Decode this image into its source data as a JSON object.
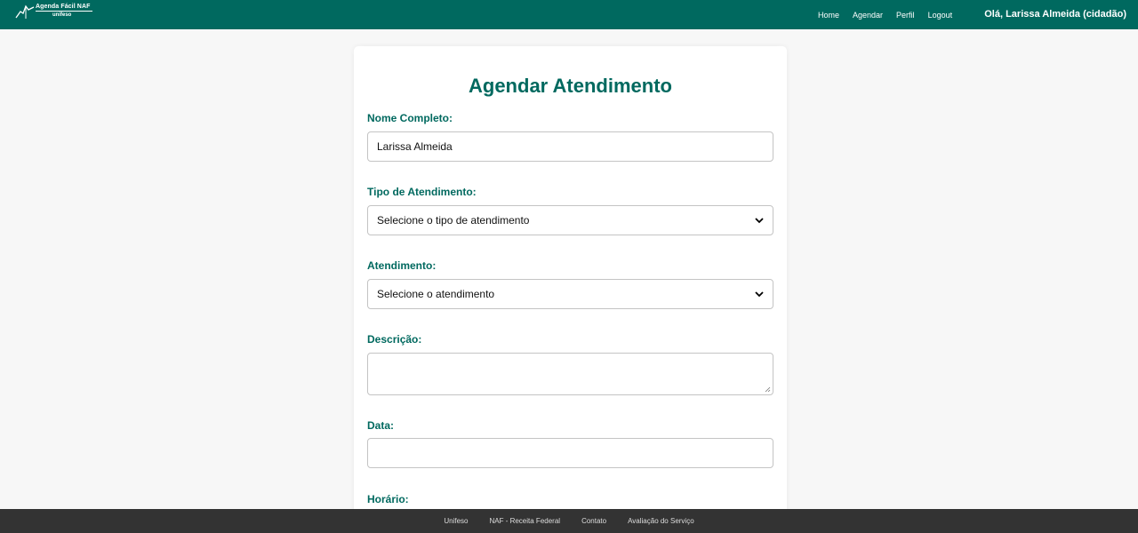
{
  "header": {
    "logo_title": "Agenda Fácil NAF",
    "logo_subtitle": "unifeso",
    "nav": [
      "Home",
      "Agendar",
      "Perfil",
      "Logout"
    ],
    "greeting": "Olá, Larissa Almeida (cidadão)"
  },
  "form": {
    "title": "Agendar Atendimento",
    "name_label": "Nome Completo:",
    "name_value": "Larissa Almeida",
    "type_label": "Tipo de Atendimento:",
    "type_value": "Selecione o tipo de atendimento",
    "service_label": "Atendimento:",
    "service_value": "Selecione o atendimento",
    "description_label": "Descrição:",
    "description_value": "",
    "date_label": "Data:",
    "date_value": "",
    "time_label": "Horário:"
  },
  "footer": {
    "links": [
      "Unifeso",
      "NAF - Receita Federal",
      "Contato",
      "Avaliação do Serviço"
    ]
  },
  "colors": {
    "primary": "#00695f",
    "footer_bg": "#333333",
    "page_bg": "#f7f7f7"
  },
  "icons": {
    "logo": "mountain-line-logo-icon",
    "select": "chevron-down-icon",
    "resize": "resize-handle-icon"
  }
}
